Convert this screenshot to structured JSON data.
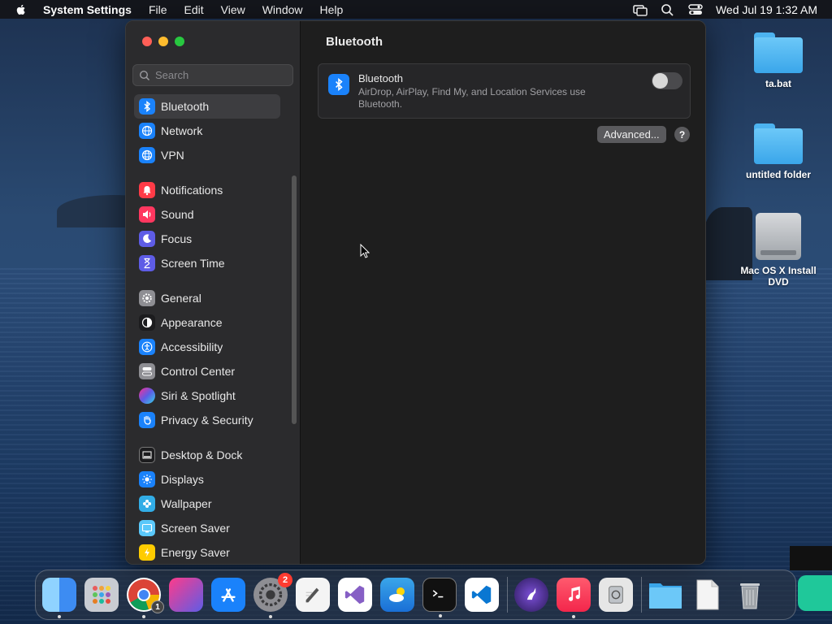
{
  "menubar": {
    "app_name": "System Settings",
    "menus": [
      "File",
      "Edit",
      "View",
      "Window",
      "Help"
    ],
    "clock": "Wed Jul 19  1:32 AM"
  },
  "window": {
    "search_placeholder": "Search",
    "sidebar": [
      {
        "label": "Bluetooth",
        "icon": "bluetooth-icon",
        "color": "#1a82fb",
        "selected": true
      },
      {
        "label": "Network",
        "icon": "globe-icon",
        "color": "#1a82fb"
      },
      {
        "label": "VPN",
        "icon": "vpn-globe-icon",
        "color": "#1a82fb"
      },
      {
        "label": "Notifications",
        "icon": "bell-icon",
        "color": "#ff3b47"
      },
      {
        "label": "Sound",
        "icon": "speaker-icon",
        "color": "#ff375f"
      },
      {
        "label": "Focus",
        "icon": "moon-icon",
        "color": "#5e5ce6"
      },
      {
        "label": "Screen Time",
        "icon": "hourglass-icon",
        "color": "#5e5ce6"
      },
      {
        "label": "General",
        "icon": "gear-icon",
        "color": "#8e8e93"
      },
      {
        "label": "Appearance",
        "icon": "appearance-icon",
        "color": "#1c1c1e"
      },
      {
        "label": "Accessibility",
        "icon": "accessibility-icon",
        "color": "#1a82fb"
      },
      {
        "label": "Control Center",
        "icon": "control-center-icon",
        "color": "#8e8e93"
      },
      {
        "label": "Siri & Spotlight",
        "icon": "siri-icon",
        "color": "#b84fd6"
      },
      {
        "label": "Privacy & Security",
        "icon": "hand-icon",
        "color": "#1a82fb"
      },
      {
        "label": "Desktop & Dock",
        "icon": "dock-icon",
        "color": "#1c1c1e"
      },
      {
        "label": "Displays",
        "icon": "sun-icon",
        "color": "#1a82fb"
      },
      {
        "label": "Wallpaper",
        "icon": "flower-icon",
        "color": "#32ade6"
      },
      {
        "label": "Screen Saver",
        "icon": "screensaver-icon",
        "color": "#5ac8fa"
      },
      {
        "label": "Energy Saver",
        "icon": "battery-icon",
        "color": "#ffcc00"
      }
    ],
    "main": {
      "title": "Bluetooth",
      "card_title": "Bluetooth",
      "card_desc": "AirDrop, AirPlay, Find My, and Location Services use Bluetooth.",
      "toggle_on": false,
      "advanced_label": "Advanced...",
      "help_label": "?"
    }
  },
  "desktop": {
    "icons": [
      {
        "label": "ta.bat",
        "kind": "folder"
      },
      {
        "label": "untitled folder",
        "kind": "folder"
      },
      {
        "label": "Mac OS X Install DVD",
        "kind": "disk"
      }
    ]
  },
  "dock": {
    "chrome_badge": "1",
    "settings_badge": "2"
  }
}
